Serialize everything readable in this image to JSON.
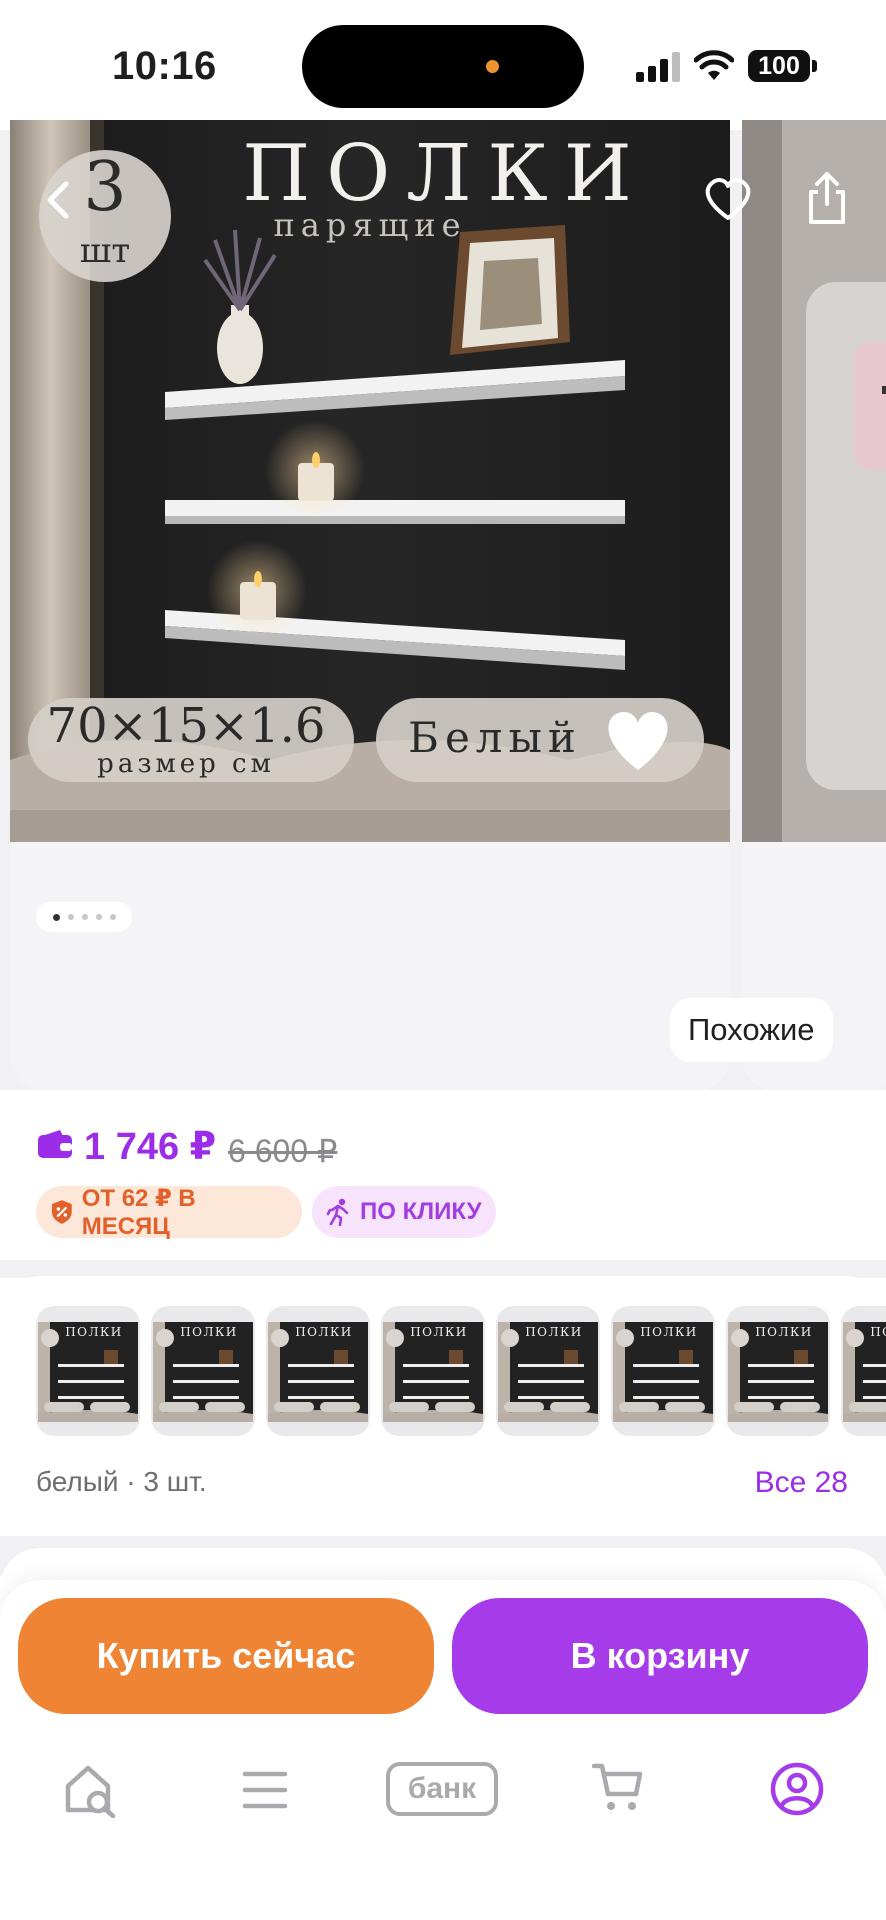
{
  "status_bar": {
    "time": "10:16",
    "battery": "100"
  },
  "gallery": {
    "image_text": {
      "count_number": "3",
      "count_unit": "шт",
      "title": "ПОЛКИ",
      "subtitle": "парящие",
      "size": "70×15×1.6",
      "size_caption": "размер см",
      "color_name": "Белый"
    },
    "similar_label": "Похожие",
    "dots_total": 5,
    "dots_active": 0
  },
  "price": {
    "current": "1 746 ₽",
    "old": "6 600 ₽",
    "installment_badge": "ОТ 62 ₽ В МЕСЯЦ",
    "click_badge": "ПО КЛИКУ"
  },
  "variants": {
    "label": "белый · 3 шт.",
    "all_link": "Все 28",
    "thumb_title": "ПОЛКИ",
    "thumb_count": 8
  },
  "actions": {
    "buy_now": "Купить сейчас",
    "add_to_cart": "В корзину"
  },
  "tabbar": {
    "bank_label": "банк",
    "items": [
      "home-search-icon",
      "catalog-menu-icon",
      "bank-icon",
      "cart-icon",
      "profile-icon"
    ]
  },
  "colors": {
    "accent_purple": "#a63bea",
    "accent_orange": "#ee8434",
    "price_purple": "#9b2ce8"
  }
}
